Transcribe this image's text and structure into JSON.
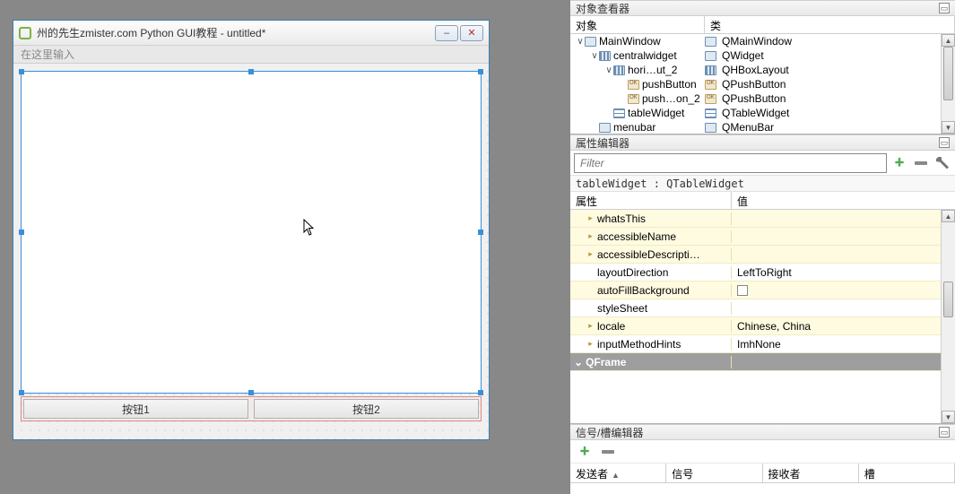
{
  "preview": {
    "title": "州的先生zmister.com Python GUI教程 - untitled*",
    "menubar_hint": "在这里输入",
    "buttons": [
      "按钮1",
      "按钮2"
    ]
  },
  "object_inspector": {
    "title": "对象查看器",
    "columns": [
      "对象",
      "类"
    ],
    "rows": [
      {
        "indent": 0,
        "twisty": "∨",
        "name": "MainWindow",
        "icon": "window",
        "class": "QMainWindow",
        "class_icon": "window"
      },
      {
        "indent": 1,
        "twisty": "∨",
        "name": "centralwidget",
        "icon": "layout",
        "class": "QWidget",
        "class_icon": "widget"
      },
      {
        "indent": 2,
        "twisty": "∨",
        "name": "hori…ut_2",
        "icon": "layout",
        "class": "QHBoxLayout",
        "class_icon": "layout"
      },
      {
        "indent": 3,
        "twisty": "",
        "name": "pushButton",
        "icon": "btn",
        "class": "QPushButton",
        "class_icon": "btn"
      },
      {
        "indent": 3,
        "twisty": "",
        "name": "push…on_2",
        "icon": "btn",
        "class": "QPushButton",
        "class_icon": "btn"
      },
      {
        "indent": 2,
        "twisty": "",
        "name": "tableWidget",
        "icon": "table",
        "class": "QTableWidget",
        "class_icon": "table"
      },
      {
        "indent": 1,
        "twisty": "",
        "name": "menubar",
        "icon": "widget",
        "class": "QMenuBar",
        "class_icon": "widget"
      }
    ]
  },
  "property_editor": {
    "title": "属性编辑器",
    "filter_placeholder": "Filter",
    "context": "tableWidget : QTableWidget",
    "columns": [
      "属性",
      "值"
    ],
    "rows": [
      {
        "expand": true,
        "yellow": true,
        "name": "whatsThis",
        "value": ""
      },
      {
        "expand": true,
        "yellow": true,
        "name": "accessibleName",
        "value": ""
      },
      {
        "expand": true,
        "yellow": true,
        "name": "accessibleDescripti…",
        "value": ""
      },
      {
        "expand": false,
        "yellow": false,
        "name": "layoutDirection",
        "value": "LeftToRight"
      },
      {
        "expand": false,
        "yellow": true,
        "name": "autoFillBackground",
        "value": "",
        "checkbox": true
      },
      {
        "expand": false,
        "yellow": false,
        "name": "styleSheet",
        "value": ""
      },
      {
        "expand": true,
        "yellow": true,
        "name": "locale",
        "value": "Chinese, China"
      },
      {
        "expand": true,
        "yellow": false,
        "name": "inputMethodHints",
        "value": "ImhNone"
      },
      {
        "group": true,
        "name": "QFrame",
        "value": ""
      }
    ]
  },
  "signal_slot": {
    "title": "信号/槽编辑器",
    "columns": [
      "发送者",
      "信号",
      "接收者",
      "槽"
    ]
  }
}
